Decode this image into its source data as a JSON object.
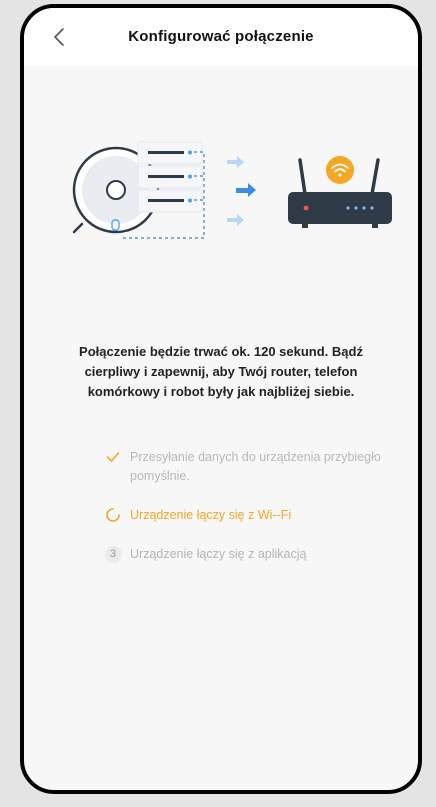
{
  "header": {
    "title": "Konfigurować połączenie"
  },
  "description": "Połączenie będzie trwać ok. 120 sekund. Bądź cierpliwy i zapewnij, aby Twój router, telefon komórkowy i robot były jak najbliżej siebie.",
  "steps": [
    {
      "label": "Przesyłanie danych do urządzenia przybiegło pomyślnie.",
      "status": "done",
      "icon": "check-icon"
    },
    {
      "label": "Urządzenie łączy się z Wi--Fi",
      "status": "active",
      "icon": "spinner-icon"
    },
    {
      "label": "Urządzenie łączy się z aplikacją",
      "status": "pending",
      "number": "3"
    }
  ],
  "colors": {
    "accent": "#f5a623",
    "router": "#2e3a45",
    "arrow_active": "#3a8ee6",
    "arrow_faded": "#b9d6f4"
  }
}
